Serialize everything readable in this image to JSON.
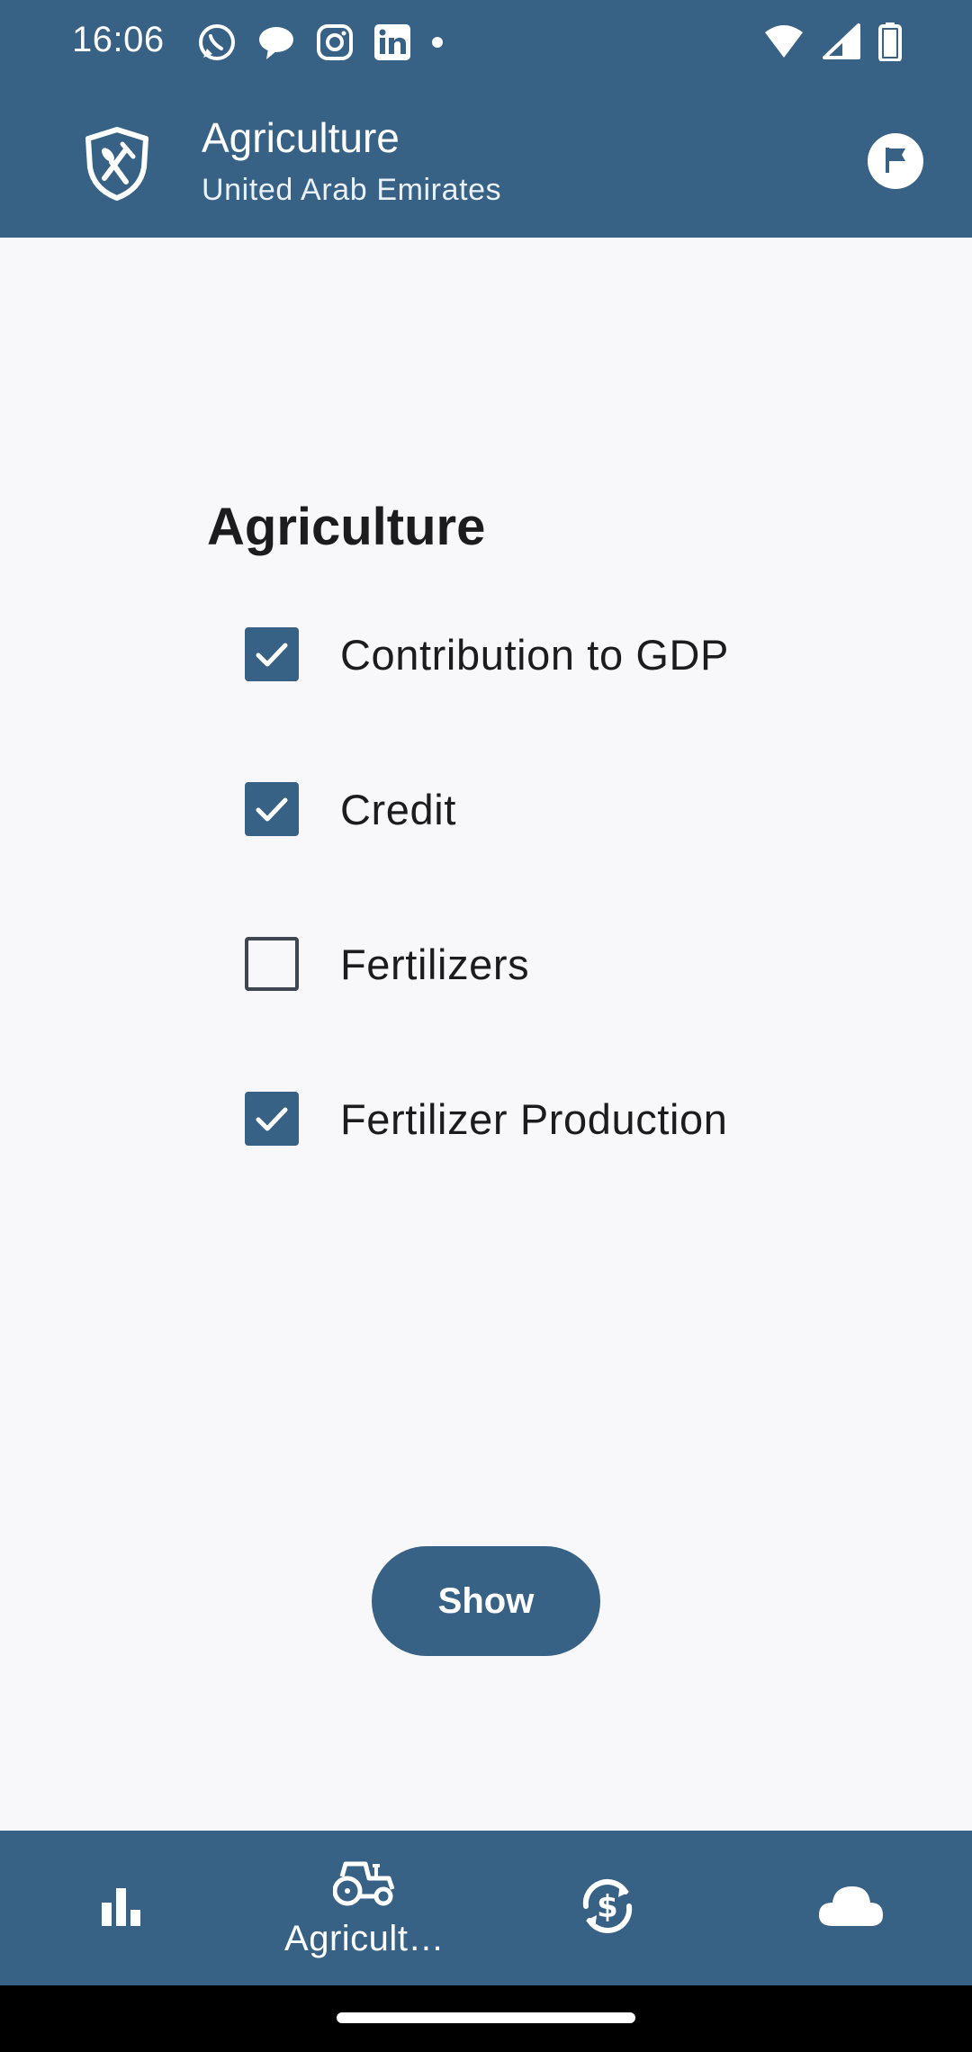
{
  "status_bar": {
    "time": "16:06",
    "notification_icons": [
      "whatsapp-icon",
      "chat-bubble-icon",
      "instagram-icon",
      "linkedin-icon",
      "dot-icon"
    ],
    "system_icons": [
      "wifi-icon",
      "cell-signal-icon",
      "battery-icon"
    ]
  },
  "app_bar": {
    "logo_icon": "shield-fork-knife-icon",
    "title": "Agriculture",
    "subtitle": "United Arab Emirates",
    "action_icon": "flag-icon"
  },
  "section": {
    "title": "Agriculture",
    "options": [
      {
        "label": "Contribution to GDP",
        "checked": true
      },
      {
        "label": "Credit",
        "checked": true
      },
      {
        "label": "Fertilizers",
        "checked": false
      },
      {
        "label": "Fertilizer Production",
        "checked": true
      }
    ]
  },
  "show_button": {
    "label": "Show"
  },
  "bottom_nav": {
    "items": [
      {
        "icon": "bar-chart-icon",
        "label": ""
      },
      {
        "icon": "tractor-icon",
        "label": "Agricult…"
      },
      {
        "icon": "currency-exchange-icon",
        "label": ""
      },
      {
        "icon": "cloud-icon",
        "label": ""
      }
    ]
  },
  "colors": {
    "primary": "#376185",
    "background": "#f8f8fb",
    "text": "#1c1c1f"
  }
}
